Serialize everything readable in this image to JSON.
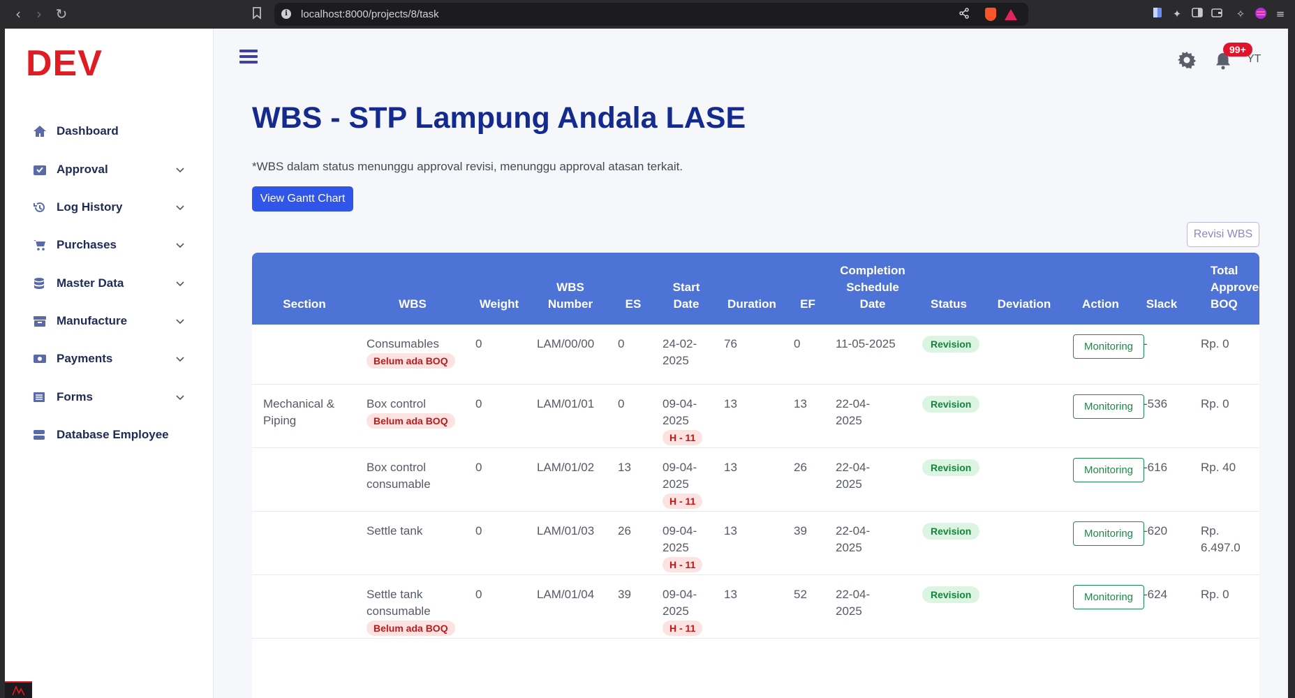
{
  "browser": {
    "url": "localhost:8000/projects/8/task"
  },
  "sidebar": {
    "logo": "DEV",
    "items": [
      {
        "label": "Dashboard",
        "icon": "home-icon",
        "has_submenu": false
      },
      {
        "label": "Approval",
        "icon": "inbox-check-icon",
        "has_submenu": true
      },
      {
        "label": "Log History",
        "icon": "history-icon",
        "has_submenu": true
      },
      {
        "label": "Purchases",
        "icon": "cart-icon",
        "has_submenu": true
      },
      {
        "label": "Master Data",
        "icon": "database-icon",
        "has_submenu": true
      },
      {
        "label": "Manufacture",
        "icon": "archive-box-icon",
        "has_submenu": true
      },
      {
        "label": "Payments",
        "icon": "money-icon",
        "has_submenu": true
      },
      {
        "label": "Forms",
        "icon": "list-icon",
        "has_submenu": true
      },
      {
        "label": "Database Employee",
        "icon": "server-icon",
        "has_submenu": false
      }
    ]
  },
  "header": {
    "notification_count": "99+",
    "user_initials": "YT"
  },
  "page": {
    "title": "WBS - STP Lampung Andala LASE",
    "note": "*WBS dalam status menunggu approval revisi, menunggu approval atasan terkait.",
    "gantt_button": "View Gantt Chart",
    "revisi_button": "Revisi WBS"
  },
  "table": {
    "headers": {
      "section": "Section",
      "wbs": "WBS",
      "weight": "Weight",
      "wbs_number_1": "WBS",
      "wbs_number_2": "Number",
      "es": "ES",
      "start_1": "Start",
      "start_2": "Date",
      "duration": "Duration",
      "ef": "EF",
      "completion_1": "Completion",
      "completion_2": "Schedule",
      "completion_3": "Date",
      "status": "Status",
      "deviation": "Deviation",
      "action": "Action",
      "slack": "Slack",
      "total_1": "Total",
      "total_2": "Approved",
      "total_3": "BOQ"
    },
    "rows": [
      {
        "section": "",
        "wbs": "Consumables",
        "boq_badge": "Belum ada BOQ",
        "weight": "0",
        "wbs_number": "LAM/00/00",
        "es": "0",
        "start_1": "24-02-",
        "start_2": "2025",
        "h_badge": "",
        "duration": "76",
        "ef": "0",
        "completion_1": "11-05-2025",
        "completion_2": "",
        "status": "Revision",
        "deviation": "",
        "action": "Monitoring",
        "slack": "-",
        "total_1": "Rp. 0",
        "total_2": ""
      },
      {
        "section": "Mechanical & Piping",
        "wbs": "Box control",
        "boq_badge": "Belum ada BOQ",
        "weight": "0",
        "wbs_number": "LAM/01/01",
        "es": "0",
        "start_1": "09-04-",
        "start_2": "2025",
        "h_badge": "H - 11",
        "duration": "13",
        "ef": "13",
        "completion_1": "22-04-",
        "completion_2": "2025",
        "status": "Revision",
        "deviation": "",
        "action": "Monitoring",
        "slack": "-536",
        "total_1": "Rp. 0",
        "total_2": ""
      },
      {
        "section": "",
        "wbs": "Box control consumable",
        "boq_badge": "",
        "weight": "0",
        "wbs_number": "LAM/01/02",
        "es": "13",
        "start_1": "09-04-",
        "start_2": "2025",
        "h_badge": "H - 11",
        "duration": "13",
        "ef": "26",
        "completion_1": "22-04-",
        "completion_2": "2025",
        "status": "Revision",
        "deviation": "",
        "action": "Monitoring",
        "slack": "-616",
        "total_1": "Rp. 40",
        "total_2": ""
      },
      {
        "section": "",
        "wbs": "Settle tank",
        "boq_badge": "",
        "weight": "0",
        "wbs_number": "LAM/01/03",
        "es": "26",
        "start_1": "09-04-",
        "start_2": "2025",
        "h_badge": "H - 11",
        "duration": "13",
        "ef": "39",
        "completion_1": "22-04-",
        "completion_2": "2025",
        "status": "Revision",
        "deviation": "",
        "action": "Monitoring",
        "slack": "-620",
        "total_1": "Rp.",
        "total_2": "6.497.0"
      },
      {
        "section": "",
        "wbs": "Settle tank consumable",
        "boq_badge": "Belum ada BOQ",
        "weight": "0",
        "wbs_number": "LAM/01/04",
        "es": "39",
        "start_1": "09-04-",
        "start_2": "2025",
        "h_badge": "H - 11",
        "duration": "13",
        "ef": "52",
        "completion_1": "22-04-",
        "completion_2": "2025",
        "status": "Revision",
        "deviation": "",
        "action": "Monitoring",
        "slack": "-624",
        "total_1": "Rp. 0",
        "total_2": ""
      }
    ]
  },
  "colors": {
    "brand_red": "#e11b22",
    "title_blue": "#152a8f",
    "table_header": "#4e73d6",
    "primary_button": "#2f56e8",
    "status_green": "#13843c"
  }
}
